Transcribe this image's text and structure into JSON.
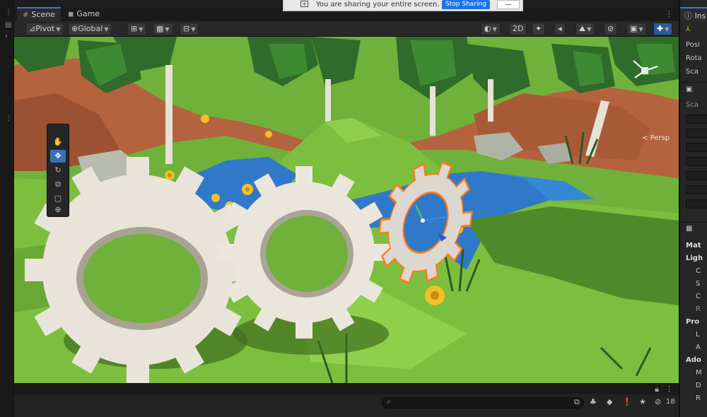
{
  "tabs": [
    {
      "label": "Scene",
      "icon": "grid-icon"
    },
    {
      "label": "Game",
      "icon": "gamepad-icon"
    }
  ],
  "share_bar": {
    "message": "You are sharing your entire screen.",
    "stop_label": "Stop Sharing",
    "hide_label": "—"
  },
  "toolbar": {
    "pivot_label": "Pivot",
    "global_label": "Global",
    "mode_2d_label": "2D"
  },
  "tools": [
    "hand-tool",
    "move-tool",
    "rotate-tool",
    "scale-tool",
    "rect-tool",
    "transform-tool"
  ],
  "scene": {
    "persp_label": "< Persp"
  },
  "inspector": {
    "tab_label": "Ins",
    "transform_rows": [
      "Posi",
      "Rota",
      "Sca"
    ],
    "component_header": "Sca",
    "material_rows": [
      {
        "label": "Mat",
        "style": "hdr"
      },
      {
        "label": "Ligh",
        "style": "hdr"
      },
      {
        "label": "C",
        "style": "normal"
      },
      {
        "label": "S",
        "style": "normal"
      },
      {
        "label": "C",
        "style": "normal"
      },
      {
        "label": "R",
        "style": "dim"
      },
      {
        "label": "Pro",
        "style": "hdr"
      },
      {
        "label": "L",
        "style": "normal"
      },
      {
        "label": "A",
        "style": "normal"
      },
      {
        "label": "Ado",
        "style": "hdr"
      },
      {
        "label": "M",
        "style": "normal"
      },
      {
        "label": "D",
        "style": "normal"
      },
      {
        "label": "R",
        "style": "normal"
      }
    ]
  },
  "console": {
    "message_count": "18"
  },
  "colors": {
    "accent": "#3a76d6",
    "selection_outline": "#ff7a1a",
    "grass": "#7cbf3f",
    "water": "#2f79c8",
    "cliff": "#b5633e"
  }
}
